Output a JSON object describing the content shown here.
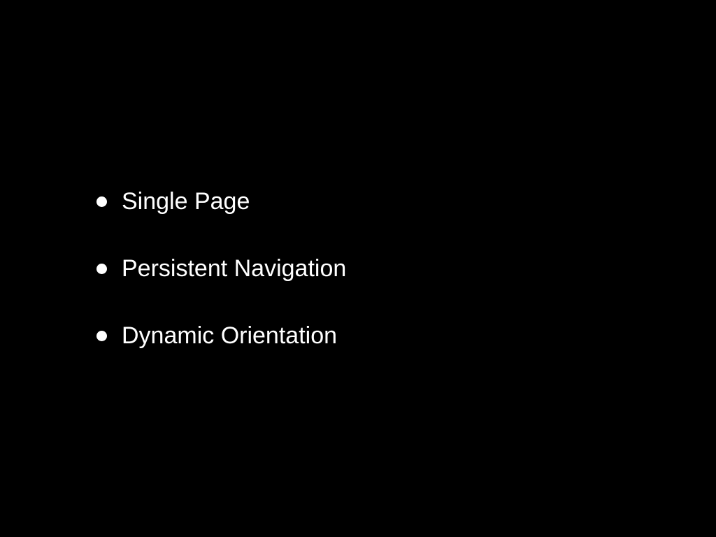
{
  "slide": {
    "background_color": "#000000",
    "text_color": "#ffffff",
    "bullets": [
      {
        "label": "Single Page"
      },
      {
        "label": "Persistent Navigation"
      },
      {
        "label": "Dynamic Orientation"
      }
    ]
  }
}
